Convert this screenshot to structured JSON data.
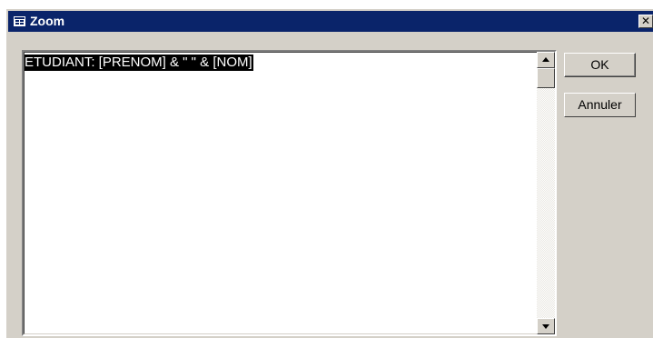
{
  "window": {
    "title": "Zoom",
    "title_icon": "form-icon",
    "close_glyph": "✕"
  },
  "editor": {
    "text": "ETUDIANT: [PRENOM] & \" \" & [NOM]",
    "selected": true
  },
  "buttons": {
    "ok_label": "OK",
    "cancel_label": "Annuler"
  },
  "colors": {
    "titlebar": "#0a246a",
    "face": "#d4d0c8",
    "selection": "#000000"
  }
}
